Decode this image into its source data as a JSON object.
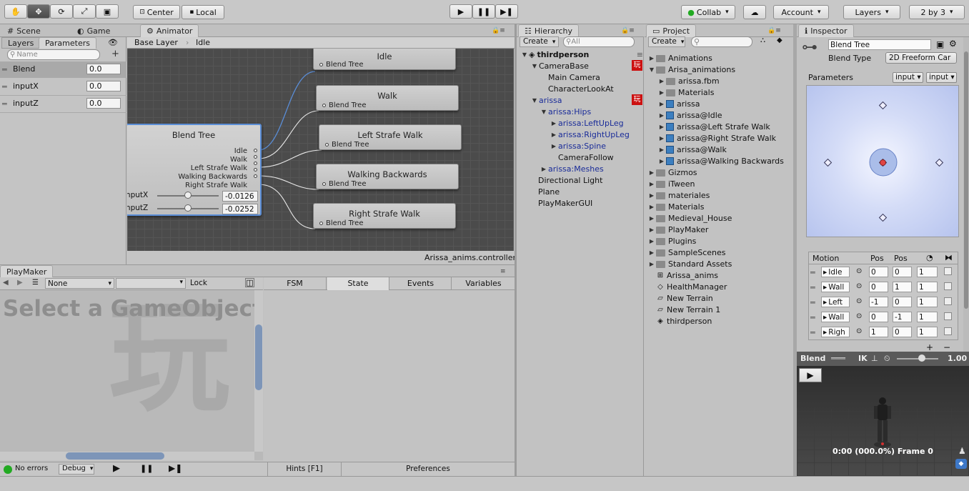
{
  "toolbar": {
    "tools": [
      "hand",
      "move",
      "rotate",
      "scale",
      "rect"
    ],
    "pivot": "Center",
    "space": "Local",
    "collab": "Collab",
    "account": "Account",
    "layers": "Layers",
    "layout": "2 by 3"
  },
  "tabs": {
    "scene": "Scene",
    "game": "Game",
    "animator": "Animator",
    "hierarchy": "Hierarchy",
    "project": "Project",
    "inspector": "Inspector",
    "playmaker": "PlayMaker"
  },
  "animator": {
    "subtabs": [
      "Layers",
      "Parameters"
    ],
    "search_placeholder": "Name",
    "params": [
      {
        "name": "Blend",
        "value": "0.0"
      },
      {
        "name": "inputX",
        "value": "0.0"
      },
      {
        "name": "inputZ",
        "value": "0.0"
      }
    ],
    "breadcrumb": [
      "Base Layer",
      "Idle"
    ],
    "blendtree": {
      "title": "Blend Tree",
      "outputs": [
        "Idle",
        "Walk",
        "Left Strafe Walk",
        "Walking Backwards",
        "Right Strafe Walk"
      ],
      "sliders": [
        {
          "label": "inputX",
          "value": "-0.0126"
        },
        {
          "label": "inputZ",
          "value": "-0.0252"
        }
      ]
    },
    "nodes": [
      {
        "title": "Idle",
        "sub": "Blend Tree"
      },
      {
        "title": "Walk",
        "sub": "Blend Tree"
      },
      {
        "title": "Left Strafe Walk",
        "sub": "Blend Tree"
      },
      {
        "title": "Walking Backwards",
        "sub": "Blend Tree"
      },
      {
        "title": "Right Strafe Walk",
        "sub": "Blend Tree"
      }
    ],
    "footer": "Arissa_anims.controller"
  },
  "hierarchy": {
    "create": "Create",
    "search": "All",
    "root": "thirdperson",
    "items": [
      "CameraBase",
      "Main Camera",
      "CharacterLookAt",
      "arissa",
      "arissa:Hips",
      "arissa:LeftUpLeg",
      "arissa:RightUpLeg",
      "arissa:Spine",
      "CameraFollow",
      "arissa:Meshes",
      "Directional Light",
      "Plane",
      "PlayMakerGUI"
    ],
    "badge": "玩"
  },
  "project": {
    "create": "Create",
    "items": [
      "Animations",
      "Arisa_animations",
      "arissa.fbm",
      "Materials",
      "arissa",
      "arissa@Idle",
      "arissa@Left Strafe Walk",
      "arissa@Right Strafe Walk",
      "arissa@Walk",
      "arissa@Walking Backwards",
      "Gizmos",
      "iTween",
      "materiales",
      "Materials",
      "Medieval_House",
      "PlayMaker",
      "Plugins",
      "SampleScenes",
      "Standard Assets",
      "Arissa_anims",
      "HealthManager",
      "New Terrain",
      "New Terrain 1",
      "thirdperson"
    ]
  },
  "inspector": {
    "name": "Blend Tree",
    "blend_type_label": "Blend Type",
    "blend_type": "2D Freeform Car",
    "parameters_label": "Parameters",
    "param1": "input",
    "param2": "input",
    "motion_headers": [
      "Motion",
      "Pos",
      "Pos"
    ],
    "motions": [
      {
        "name": "Idle",
        "x": "0",
        "y": "0",
        "s": "1"
      },
      {
        "name": "Wall",
        "x": "0",
        "y": "1",
        "s": "1"
      },
      {
        "name": "Left",
        "x": "-1",
        "y": "0",
        "s": "1"
      },
      {
        "name": "Wall",
        "x": "0",
        "y": "-1",
        "s": "1"
      },
      {
        "name": "Righ",
        "x": "1",
        "y": "0",
        "s": "1"
      }
    ],
    "preview": {
      "title": "Blend",
      "ik": "IK",
      "speed": "1.00",
      "time": "0:00 (000.0%) Frame 0"
    }
  },
  "playmaker": {
    "none": "None",
    "lock": "Lock",
    "tabs": [
      "FSM",
      "State",
      "Events",
      "Variables"
    ],
    "placeholder": "Select a GameObject",
    "hints": "Hints [F1]",
    "preferences": "Preferences",
    "status": "No errors",
    "debug": "Debug"
  },
  "colors": {
    "accent": "#5a8dd6",
    "error": "#cc1111",
    "ok": "#22aa22"
  }
}
